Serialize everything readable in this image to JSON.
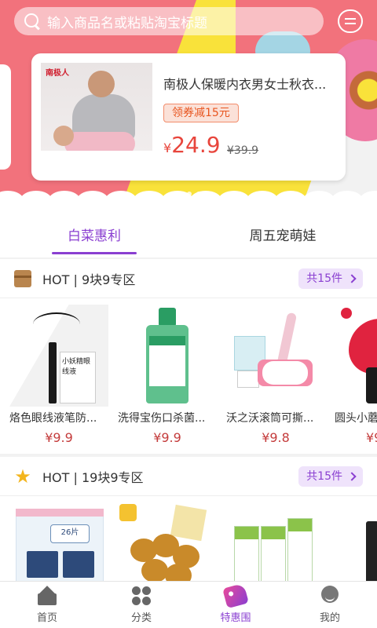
{
  "search": {
    "placeholder": "输入商品名或粘贴淘宝标题"
  },
  "banner": {
    "brand": "南极人",
    "title": "南极人保暖内衣男女士秋衣...",
    "coupon": "领券减15元",
    "price_symbol": "¥",
    "price": "24.9",
    "old_price": "¥39.9",
    "active_slide": 1,
    "slide_count": 3
  },
  "tabs": [
    {
      "label": "白菜惠利",
      "active": true
    },
    {
      "label": "周五宠萌娃",
      "active": false
    }
  ],
  "sections": [
    {
      "icon": "box-icon",
      "title": "HOT | 9块9专区",
      "count": "共15件",
      "products": [
        {
          "name": "烙色眼线液笔防...",
          "price": "¥9.9",
          "img_label": "小妖精眼线液"
        },
        {
          "name": "洗得宝伤口杀菌...",
          "price": "¥9.9"
        },
        {
          "name": "沃之沃滚筒可撕...",
          "price": "¥9.8"
        },
        {
          "name": "圆头小蘑",
          "price": "¥9"
        }
      ]
    },
    {
      "icon": "star-icon",
      "title": "HOT | 19块9专区",
      "count": "共15件",
      "products": [
        {
          "name": "",
          "price": "",
          "img_label": "26片"
        },
        {
          "name": "",
          "price": ""
        },
        {
          "name": "",
          "price": ""
        },
        {
          "name": "",
          "price": ""
        }
      ]
    }
  ],
  "bottom_nav": [
    {
      "label": "首页",
      "icon": "home-icon",
      "active": false
    },
    {
      "label": "分类",
      "icon": "grid-icon",
      "active": false
    },
    {
      "label": "特惠围",
      "icon": "tag-icon",
      "active": true
    },
    {
      "label": "我的",
      "icon": "me-icon",
      "active": false
    }
  ],
  "colors": {
    "accent": "#8a3fd1",
    "price": "#c43c3c",
    "hero_pink": "#f2727c",
    "hero_yellow": "#f9e23a"
  }
}
